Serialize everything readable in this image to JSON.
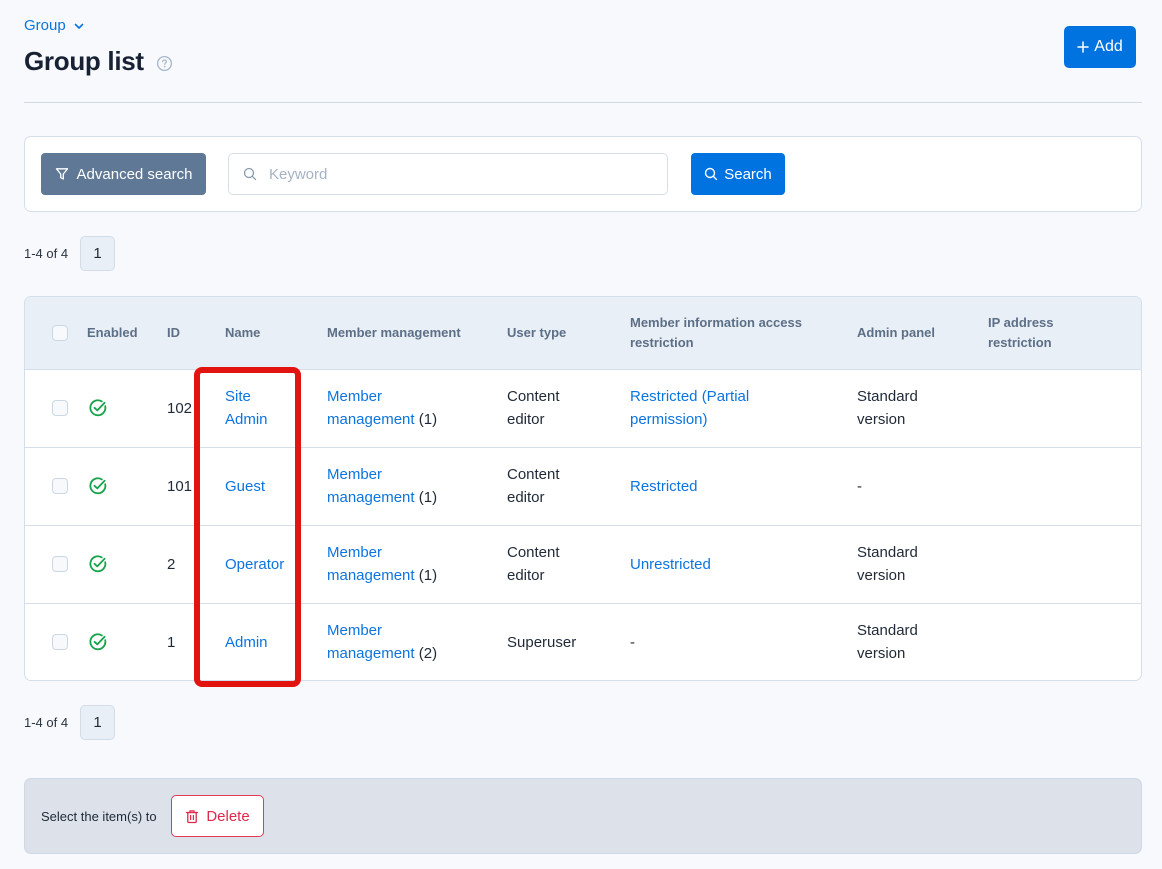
{
  "header": {
    "breadcrumb": "Group",
    "title": "Group list",
    "add_button": "Add"
  },
  "search": {
    "advanced_button": "Advanced search",
    "keyword_placeholder": "Keyword",
    "keyword_value": "",
    "search_button": "Search"
  },
  "pagination": {
    "range_text": "1-4 of 4",
    "pages": [
      "1"
    ],
    "current_page": "1"
  },
  "table": {
    "columns": [
      "",
      "Enabled",
      "ID",
      "Name",
      "Member management",
      "User type",
      "Member information access restriction",
      "Admin panel",
      "IP address restriction"
    ],
    "rows": [
      {
        "enabled": true,
        "id": "102",
        "name": "Site Admin",
        "member_link": "Member management",
        "member_count": "(1)",
        "user_type": "Content editor",
        "access": "Restricted (Partial permission)",
        "access_is_link": true,
        "admin_panel": "Standard version",
        "ip_restriction": ""
      },
      {
        "enabled": true,
        "id": "101",
        "name": "Guest",
        "member_link": "Member management",
        "member_count": "(1)",
        "user_type": "Content editor",
        "access": "Restricted",
        "access_is_link": true,
        "admin_panel": "-",
        "ip_restriction": ""
      },
      {
        "enabled": true,
        "id": "2",
        "name": "Operator",
        "member_link": "Member management",
        "member_count": "(1)",
        "user_type": "Content editor",
        "access": "Unrestricted",
        "access_is_link": true,
        "admin_panel": "Standard version",
        "ip_restriction": ""
      },
      {
        "enabled": true,
        "id": "1",
        "name": "Admin",
        "member_link": "Member management",
        "member_count": "(2)",
        "user_type": "Superuser",
        "access": "-",
        "access_is_link": false,
        "admin_panel": "Standard version",
        "ip_restriction": ""
      }
    ]
  },
  "bulk_actions": {
    "label": "Select the item(s) to",
    "delete_button": "Delete"
  },
  "icons": {
    "breadcrumb_caret": "chevron-down-icon",
    "help": "question-circle-icon",
    "add": "plus-icon",
    "advanced": "filter-icon",
    "keyword": "search-icon",
    "search_button": "search-icon",
    "enabled": "check-circle-icon",
    "delete": "trash-icon"
  },
  "colors": {
    "primary": "#0073e0",
    "link": "#0b74de",
    "advanced_button": "#5f7896",
    "enabled_green": "#16a34a",
    "danger": "#e0284a",
    "highlight": "#e1140f"
  }
}
